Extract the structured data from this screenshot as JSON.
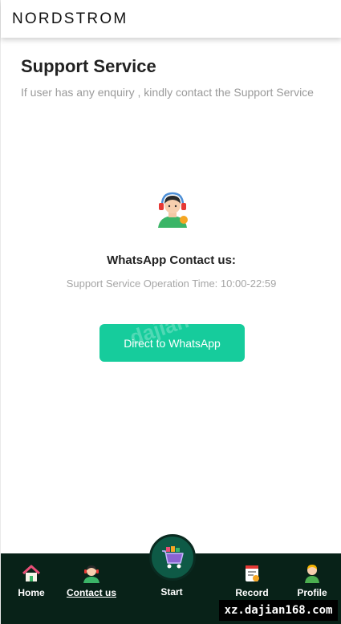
{
  "app": {
    "brand": "NORDSTROM"
  },
  "header": {
    "title": "Support Service",
    "subtitle": "If user has any enquiry , kindly contact the Support Service"
  },
  "contact": {
    "agent_icon": "support-agent-icon",
    "title": "WhatsApp Contact us:",
    "hours": "Support Service Operation Time: 10:00-22:59",
    "button_label": "Direct to WhatsApp",
    "button_color": "#16cc9c",
    "overlay_watermark": "dajian"
  },
  "bottom_nav": {
    "background": "#082218",
    "items": [
      {
        "label": "Home",
        "icon": "home-icon",
        "active": false
      },
      {
        "label": "Contact us",
        "icon": "support-agent-icon",
        "active": true
      },
      {
        "label": "Start",
        "icon": "shopping-cart-icon",
        "active": false
      },
      {
        "label": "Record",
        "icon": "record-icon",
        "active": false
      },
      {
        "label": "Profile",
        "icon": "profile-icon",
        "active": false
      }
    ]
  },
  "watermark": {
    "text": "xz.dajian168.com"
  }
}
